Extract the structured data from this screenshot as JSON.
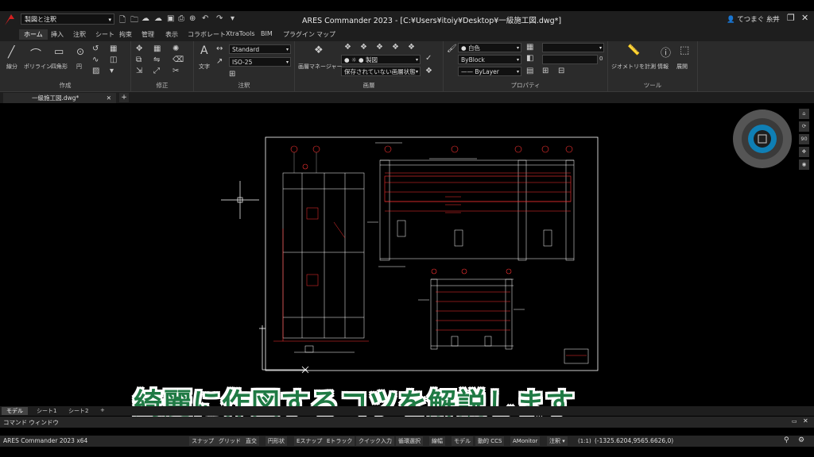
{
  "titlebar": {
    "workspace": "製図と注釈",
    "title": "ARES Commander 2023 - [C:¥Users¥itoiy¥Desktop¥一級施工図.dwg*]",
    "user": "てつまぐ 糸井"
  },
  "tabs": [
    "ホーム",
    "挿入",
    "注釈",
    "シート",
    "拘束",
    "管理",
    "表示",
    "コラボレート",
    "XtraTools",
    "BIM",
    "プラグイン",
    "マップ"
  ],
  "ribbon": {
    "draw": {
      "label": "作成",
      "line": "線分",
      "polyline": "ポリライン",
      "rect": "四角形",
      "circle": "円"
    },
    "modify": {
      "label": "修正"
    },
    "annotate": {
      "label": "注釈",
      "text": "文字",
      "text_style": "Standard",
      "dim_style": "ISO-25"
    },
    "layers": {
      "label": "画層",
      "manager": "画層マネージャー",
      "current_layer": "製図",
      "saved_state": "保存されていない画層状態"
    },
    "properties": {
      "label": "プロパティ",
      "color": "白色",
      "linetype": "ByBlock",
      "lineweight": "ByLayer",
      "transparency": "0"
    },
    "tools": {
      "label": "ツール",
      "measure": "ジオメトリを計測",
      "info": "情報",
      "expand": "展開"
    }
  },
  "doc_tab": "一級施工図.dwg*",
  "nav": {
    "zoom": "90"
  },
  "caption": "綺麗に作図するコツを解説します",
  "layout_tabs": [
    "モデル",
    "シート1",
    "シート2"
  ],
  "command": {
    "title": "コマンド ウィンドウ"
  },
  "status": {
    "app": "ARES Commander 2023 x64",
    "buttons": [
      "スナップ",
      "グリッド",
      "直交",
      "円形状",
      "Eスナップ",
      "Eトラック",
      "クイック入力",
      "循環選択",
      "線幅",
      "モデル",
      "動的 CCS",
      "AMonitor"
    ],
    "annotation": "注釈",
    "scale": "(1:1)",
    "coords": "(-1325.6204,9565.6626,0)"
  },
  "colors": {
    "accent": "#1f7a44",
    "drawing_red": "#ff3333",
    "drawing_white": "#ffffff"
  }
}
